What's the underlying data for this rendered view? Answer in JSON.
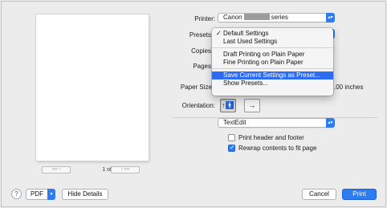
{
  "preview": {
    "page_indicator": "1 of 1",
    "first_btn": "««",
    "prev_btn": "‹",
    "next_btn": "›",
    "last_btn": "»»"
  },
  "printer": {
    "label": "Printer:",
    "value_prefix": "Canon",
    "value_suffix": "series"
  },
  "presets": {
    "label": "Presets",
    "menu_items": [
      "Default Settings",
      "Last Used Settings",
      "Draft Printing on Plain Paper",
      "Fine Printing on Plain Paper",
      "Save Current Settings as Preset...",
      "Show Presets..."
    ],
    "checked_item": "Default Settings",
    "highlighted_item": "Save Current Settings as Preset..."
  },
  "copies": {
    "label": "Copies"
  },
  "pages": {
    "label": "Pages"
  },
  "paper_size": {
    "label": "Paper Size",
    "unit_fragment": ".00 inches"
  },
  "orientation": {
    "label": "Orientation:",
    "selected": "portrait"
  },
  "app_section": {
    "value": "TextEdit"
  },
  "options": {
    "print_header_footer": {
      "label": "Print header and footer",
      "checked": false
    },
    "rewrap": {
      "label": "Rewrap contents to fit page",
      "checked": true
    }
  },
  "bottom": {
    "help": "?",
    "pdf": "PDF",
    "hide_details": "Hide Details",
    "cancel": "Cancel",
    "print": "Print"
  },
  "colors": {
    "accent": "#2d7cf0",
    "highlight": "#2d6bf0"
  },
  "icons": {
    "popup_arrow": "chevron-updown-icon",
    "portrait": "portrait-orientation-icon",
    "landscape": "landscape-orientation-icon",
    "help": "help-icon"
  }
}
